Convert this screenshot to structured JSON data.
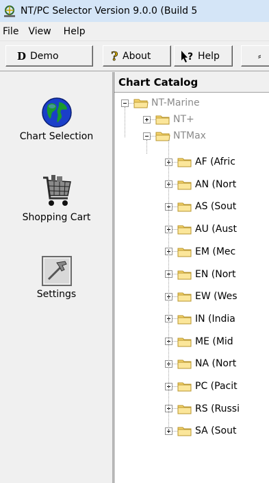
{
  "window": {
    "title": "NT/PC Selector Version 9.0.0 (Build 5"
  },
  "menu": [
    "File",
    "View",
    "Help"
  ],
  "toolbar": {
    "demo_letter": "D",
    "demo_label": "Demo",
    "about_label": "About",
    "help_label": "Help"
  },
  "sidebar": {
    "items": [
      {
        "label": "Chart Selection",
        "icon": "globe-icon"
      },
      {
        "label": "Shopping Cart",
        "icon": "shopping-cart-icon"
      },
      {
        "label": "Settings",
        "icon": "hammer-icon"
      }
    ]
  },
  "catalog": {
    "header": "Chart Catalog",
    "root": "NT-Marine",
    "groups": [
      "NT+",
      "NTMax"
    ],
    "regions": [
      "AF (Afric",
      "AN (Nort",
      "AS (Sout",
      "AU (Aust",
      "EM (Mec",
      "EN (Nort",
      "EW (Wes",
      "IN (India",
      "ME (Mid",
      "NA (Nort",
      "PC (Pacit",
      "RS (Russi",
      "SA (Sout"
    ]
  }
}
